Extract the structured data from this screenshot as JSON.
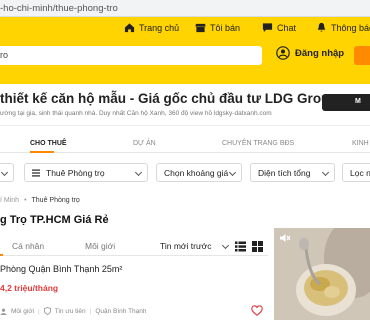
{
  "browser": {
    "url": "-ho-chi-minh/thue-phong-tro"
  },
  "header": {
    "nav": [
      {
        "label": "Trang chủ",
        "icon": "home-icon"
      },
      {
        "label": "Tôi bán",
        "icon": "shop-icon"
      },
      {
        "label": "Chat",
        "icon": "chat-icon"
      },
      {
        "label": "Thông báo",
        "icon": "bell-icon"
      }
    ],
    "search_text": "ro",
    "login_label": "Đăng nhập"
  },
  "banner": {
    "title": "thiết kế căn hộ mẫu - Giá gốc chủ đầu tư LDG Group",
    "subtitle": "ường tại gia, sinh thái quanh nhà. Duy nhất Căn hộ Xanh, 360 độ view hồ ldgsky-datxanh.com",
    "button_label": "M"
  },
  "tabs": [
    {
      "label": "CHO THUÊ",
      "active": true
    },
    {
      "label": "DỰ ÁN",
      "active": false
    },
    {
      "label": "CHUYÊN TRANG BĐS",
      "active": false
    },
    {
      "label": "KINH",
      "active": false
    }
  ],
  "filters": [
    "Thuê Phòng trọ",
    "Chọn khoảng giá",
    "Diện tích tổng",
    "Lọc nâ"
  ],
  "breadcrumb": {
    "parent": "í Minh",
    "current": "Thuê Phòng trọ"
  },
  "page_title": "g Trọ TP.HCM Giá Rẻ",
  "sub_tabs": {
    "personal": "Cá nhân",
    "broker": "Môi giới",
    "sort": "Tin mới trước"
  },
  "listing": {
    "title": "Phòng Quận Bình Thạnh 25m²",
    "price": "4,2 triệu/tháng",
    "seller": "Môi giới",
    "priority": "Tin ưu tiên",
    "location": "Quận Bình Thạnh"
  },
  "colors": {
    "brand": "#ffd400",
    "accent": "#ff8a00",
    "price": "#e03a3a"
  }
}
